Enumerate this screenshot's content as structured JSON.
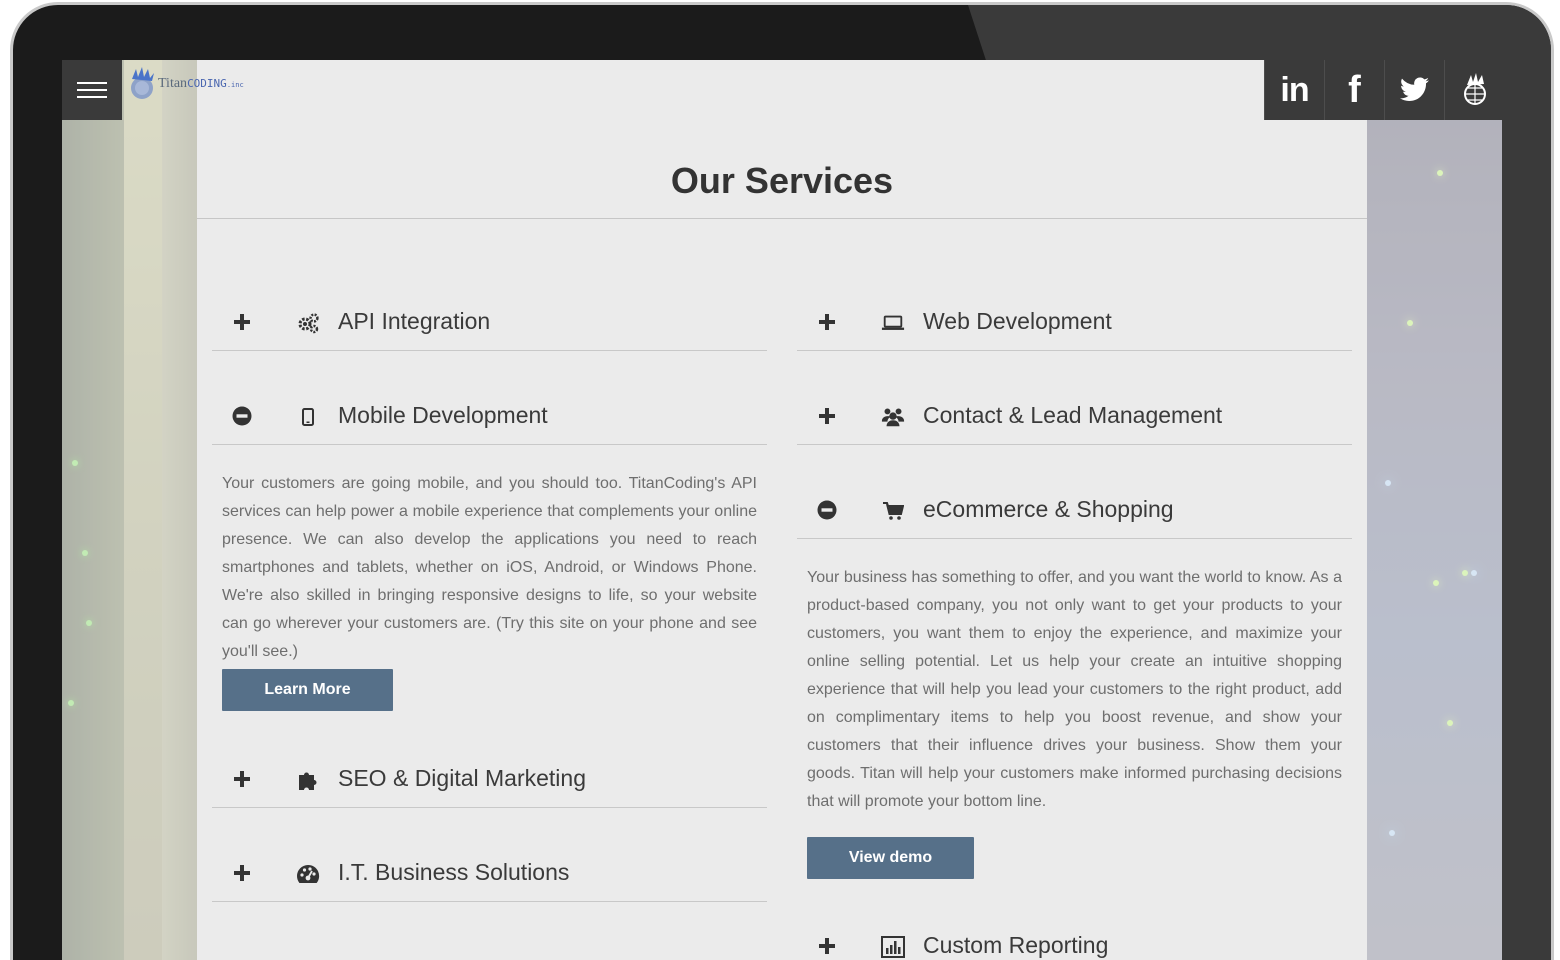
{
  "header": {
    "menu_label": "Menu",
    "logo": {
      "text_titan": "Titan",
      "text_coding": "CODING",
      "text_inc": ".inc"
    },
    "social": [
      {
        "name": "linkedin",
        "label": "in"
      },
      {
        "name": "facebook",
        "label": "f"
      },
      {
        "name": "twitter",
        "label": "twitter"
      },
      {
        "name": "titan",
        "label": "titan"
      }
    ]
  },
  "main": {
    "title": "Our Services",
    "left_column": [
      {
        "label": "API Integration",
        "icon": "gears-icon",
        "expanded": false
      },
      {
        "label": "Mobile Development",
        "icon": "mobile-icon",
        "expanded": true,
        "body": "Your customers are going mobile, and you should too. TitanCoding's API services can help power a mobile experience that complements your online presence. We can also develop the applications you need to reach smartphones and tablets, whether on iOS, Android, or Windows Phone. We're also skilled in bringing responsive designs to life, so your website can go wherever your customers are. (Try this site on your phone and see you'll see.)",
        "button": "Learn More"
      },
      {
        "label": "SEO & Digital Marketing",
        "icon": "puzzle-icon",
        "expanded": false
      },
      {
        "label": "I.T. Business Solutions",
        "icon": "dashboard-icon",
        "expanded": false
      }
    ],
    "right_column": [
      {
        "label": "Web Development",
        "icon": "laptop-icon",
        "expanded": false
      },
      {
        "label": "Contact & Lead Management",
        "icon": "users-icon",
        "expanded": false
      },
      {
        "label": "eCommerce & Shopping",
        "icon": "cart-icon",
        "expanded": true,
        "body": "Your business has something to offer, and you want the world to know. As a product-based company, you not only want to get your products to your customers, you want them to enjoy the experience, and maximize your online selling potential. Let us help your create an intuitive shopping experience that will help you lead your customers to the right product, add on complimentary items to help you boost revenue, and show your customers that their influence drives your business. Show them your goods. Titan will help your customers make informed purchasing decisions that will promote your bottom line.",
        "button": "View demo"
      },
      {
        "label": "Custom Reporting",
        "icon": "bar-chart-icon",
        "expanded": false
      }
    ]
  },
  "colors": {
    "panel_bg": "#ebebeb",
    "button_bg": "#567089",
    "dark_bar": "#3a3a3a",
    "heading": "#333333",
    "body_text": "#6e6e6e"
  }
}
